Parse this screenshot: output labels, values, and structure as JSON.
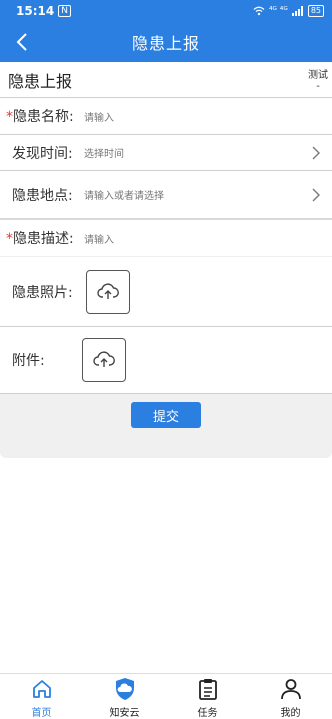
{
  "status_bar": {
    "time": "15:14",
    "nfc": "N",
    "network": "⁴ᴳ ⁴ᴳ",
    "battery": "85"
  },
  "header": {
    "title": "隐患上报"
  },
  "section": {
    "title": "隐患上报",
    "tag": "测试",
    "tag_sub": "-"
  },
  "form": {
    "name": {
      "required": "*",
      "label": "隐患名称:",
      "placeholder": "请输入"
    },
    "time": {
      "label": "发现时间:",
      "placeholder": "选择时间"
    },
    "location": {
      "label": "隐患地点:",
      "placeholder": "请输入或者请选择"
    },
    "desc": {
      "required": "*",
      "label": "隐患描述:",
      "placeholder": "请输入"
    },
    "photo": {
      "label": "隐患照片:"
    },
    "attachment": {
      "label": "附件:"
    }
  },
  "submit_label": "提交",
  "tabs": [
    {
      "label": "首页",
      "icon": "home-icon"
    },
    {
      "label": "知安云",
      "icon": "cloud-shield-icon"
    },
    {
      "label": "任务",
      "icon": "clipboard-icon"
    },
    {
      "label": "我的",
      "icon": "person-icon"
    }
  ],
  "colors": {
    "accent": "#2b7fe0",
    "required": "#e53935"
  }
}
